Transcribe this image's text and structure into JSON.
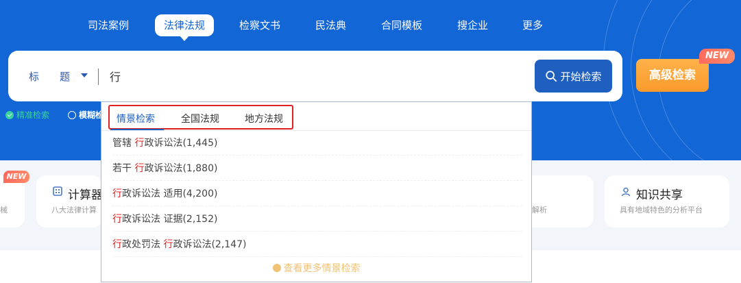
{
  "nav": {
    "items": [
      {
        "label": "司法案例"
      },
      {
        "label": "法律法规",
        "active": true
      },
      {
        "label": "检察文书"
      },
      {
        "label": "民法典"
      },
      {
        "label": "合同模板"
      },
      {
        "label": "搜企业"
      },
      {
        "label": "更多"
      }
    ]
  },
  "search": {
    "field_label_1": "标",
    "field_label_2": "题",
    "query": "行",
    "search_button": "开始检索",
    "advanced_button": "高级检索",
    "new_badge": "NEW"
  },
  "options": {
    "exact": "精准检索",
    "fuzzy": "模糊检"
  },
  "dropdown": {
    "tabs": [
      {
        "label": "情景检索",
        "active": true
      },
      {
        "label": "全国法规"
      },
      {
        "label": "地方法规"
      }
    ],
    "suggestions": [
      {
        "pre": "管辖 ",
        "hl": "行",
        "post": "政诉讼法(1,445)"
      },
      {
        "pre": "若干 ",
        "hl": "行",
        "post": "政诉讼法(1,880)"
      },
      {
        "pre": "",
        "hl": "行",
        "post": "政诉讼法 适用(4,200)"
      },
      {
        "pre": "",
        "hl": "行",
        "post": "政诉讼法 证据(2,152)"
      },
      {
        "pre": "",
        "hl": "行",
        "post": "政处罚法 ",
        "hl2": "行",
        "post2": "政诉讼法(2,147)"
      }
    ],
    "more": "查看更多情景检索"
  },
  "cards": {
    "left_new_badge": "NEW",
    "left_sub": "械",
    "calc_title": "计算器",
    "calc_sub": "八大法律计算",
    "mid_sub": "解析",
    "share_title": "知识共享",
    "share_sub": "具有地域特色的分析平台"
  },
  "colors": {
    "brand_blue": "#1366d6",
    "button_blue": "#1f5fbf",
    "advanced_orange": "#f99a2c",
    "badge_red": "#ff6a5c",
    "highlight_red": "#e02020",
    "check_green": "#38d39f"
  }
}
